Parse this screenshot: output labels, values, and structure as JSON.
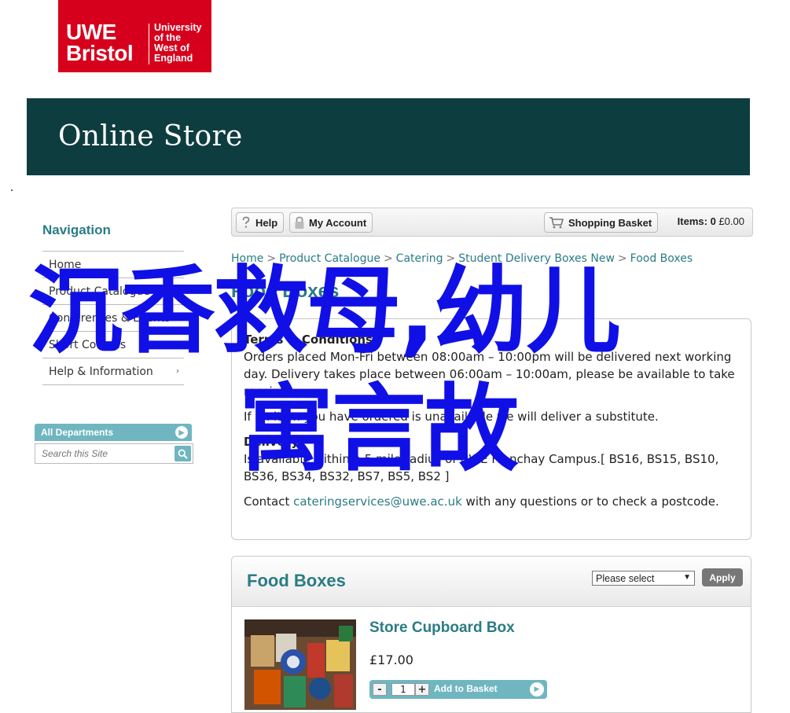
{
  "logo": {
    "line1": "UWE",
    "line2": "Bristol",
    "sub": [
      "University",
      "of the",
      "West of",
      "England"
    ]
  },
  "banner": {
    "title": "Online Store"
  },
  "sidebar": {
    "heading": "Navigation",
    "items": [
      {
        "label": "Home",
        "has_chevron": false
      },
      {
        "label": "Product Catalogue",
        "has_chevron": true
      },
      {
        "label": "Conferences & Events",
        "has_chevron": true
      },
      {
        "label": "Short Courses",
        "has_chevron": true
      },
      {
        "label": "Help & Information",
        "has_chevron": true
      }
    ],
    "departments_label": "All Departments",
    "search_placeholder": "Search this Site"
  },
  "toolbar": {
    "help": "Help",
    "account": "My Account",
    "basket": "Shopping Basket",
    "items_label": "Items:",
    "items_count": "0",
    "total": "£0.00"
  },
  "breadcrumb": [
    "Home",
    "Product Catalogue",
    "Catering",
    "Student Delivery Boxes New",
    "Food Boxes"
  ],
  "page_title": "Food Boxes",
  "terms": {
    "heading": "Terms & Conditions",
    "p1": "Orders placed Mon-Fri between 08:00am – 10:00pm will be delivered next working day. Delivery takes place between 06:00am – 10:00am, please be available to take receipt.",
    "p2": "If an item you have ordered is unavailable we will deliver a substitute.",
    "delivery_heading": "Delivery",
    "p3": "Is available within a 5 mile radius of UWE Frenchay Campus.[ BS16, BS15, BS10, BS36, BS34, BS32, BS7, BS5, BS2 ]",
    "contact_prefix": "Contact ",
    "contact_email": "cateringservices@uwe.ac.uk",
    "contact_suffix": " with any questions or to check a postcode."
  },
  "food_boxes": {
    "title": "Food Boxes",
    "select_value": "Please select",
    "apply": "Apply",
    "product": {
      "name": "Store Cupboard Box",
      "price": "£17.00",
      "qty": "1",
      "add_label": "Add to Basket"
    }
  },
  "overlay": {
    "line1": "沉香救母,幼儿",
    "line2": "寓言故"
  },
  "colors": {
    "brand_red": "#d7001c",
    "banner": "#0e3d40",
    "accent_teal": "#2a7c85",
    "button_teal": "#6fb6c1",
    "overlay_blue": "#1010e6"
  }
}
